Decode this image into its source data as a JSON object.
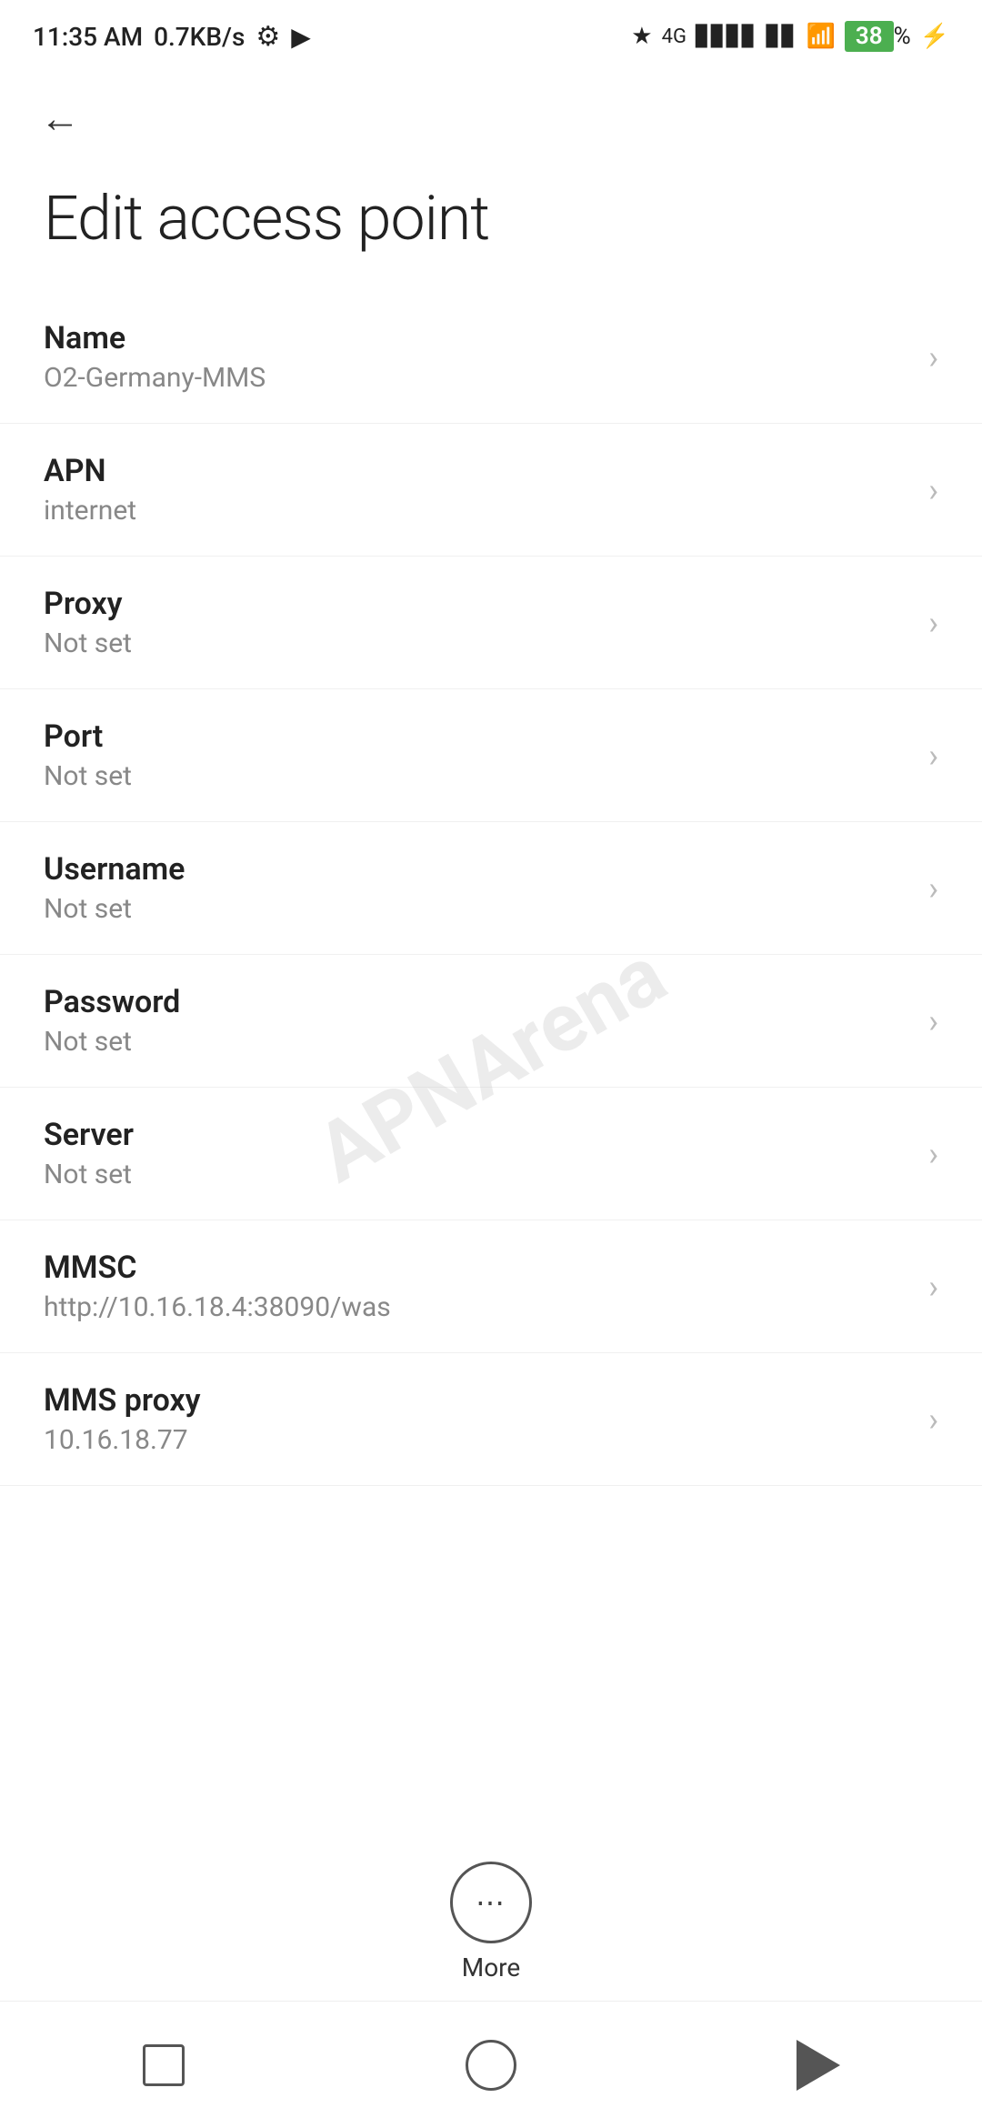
{
  "statusBar": {
    "time": "11:35 AM",
    "network": "0.7KB/s",
    "battery": "38"
  },
  "page": {
    "title": "Edit access point",
    "backLabel": "Back"
  },
  "settings": [
    {
      "label": "Name",
      "value": "O2-Germany-MMS"
    },
    {
      "label": "APN",
      "value": "internet"
    },
    {
      "label": "Proxy",
      "value": "Not set"
    },
    {
      "label": "Port",
      "value": "Not set"
    },
    {
      "label": "Username",
      "value": "Not set"
    },
    {
      "label": "Password",
      "value": "Not set"
    },
    {
      "label": "Server",
      "value": "Not set"
    },
    {
      "label": "MMSC",
      "value": "http://10.16.18.4:38090/was"
    },
    {
      "label": "MMS proxy",
      "value": "10.16.18.77"
    }
  ],
  "more": {
    "label": "More"
  },
  "watermark": "APNArena"
}
